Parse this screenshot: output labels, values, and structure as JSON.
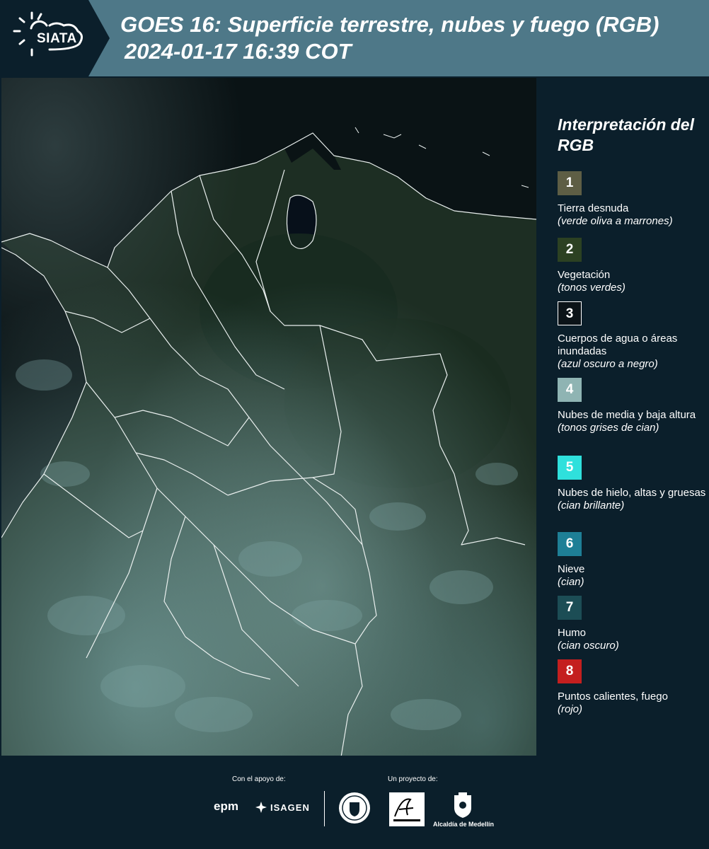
{
  "header": {
    "logo_text": "SIATA",
    "title_line1": "GOES 16: Superficie terrestre, nubes y fuego (RGB)",
    "title_line2": "2024-01-17 16:39 COT"
  },
  "legend": {
    "title": "Interpretación del RGB",
    "items": [
      {
        "number": "1",
        "label": "Tierra desnuda",
        "sub": "(verde oliva a marrones)",
        "color": "#5e5e45"
      },
      {
        "number": "2",
        "label": "Vegetación",
        "sub": "(tonos verdes)",
        "color": "#2c4122"
      },
      {
        "number": "3",
        "label": "Cuerpos de agua o áreas inundadas",
        "sub": "(azul oscuro a negro)",
        "color": "#0b1318"
      },
      {
        "number": "4",
        "label": "Nubes de media y baja altura",
        "sub": "(tonos grises de cian)",
        "color": "#8fb4b3"
      },
      {
        "number": "5",
        "label": "Nubes de hielo, altas y gruesas",
        "sub": "(cian brillante)",
        "color": "#2fe0dc"
      },
      {
        "number": "6",
        "label": "Nieve",
        "sub": "(cian)",
        "color": "#1e7f96"
      },
      {
        "number": "7",
        "label": "Humo",
        "sub": "(cian oscuro)",
        "color": "#1c4d55"
      },
      {
        "number": "8",
        "label": "Puntos calientes, fuego",
        "sub": "(rojo)",
        "color": "#c41f1f"
      }
    ]
  },
  "footer": {
    "support_label": "Con el apoyo de:",
    "project_label": "Un proyecto de:",
    "sponsor_1": "epm",
    "sponsor_2": "ISAGEN",
    "partner_area": "Área Metropolitana",
    "partner_alcaldia": "Alcaldía de Medellín"
  }
}
